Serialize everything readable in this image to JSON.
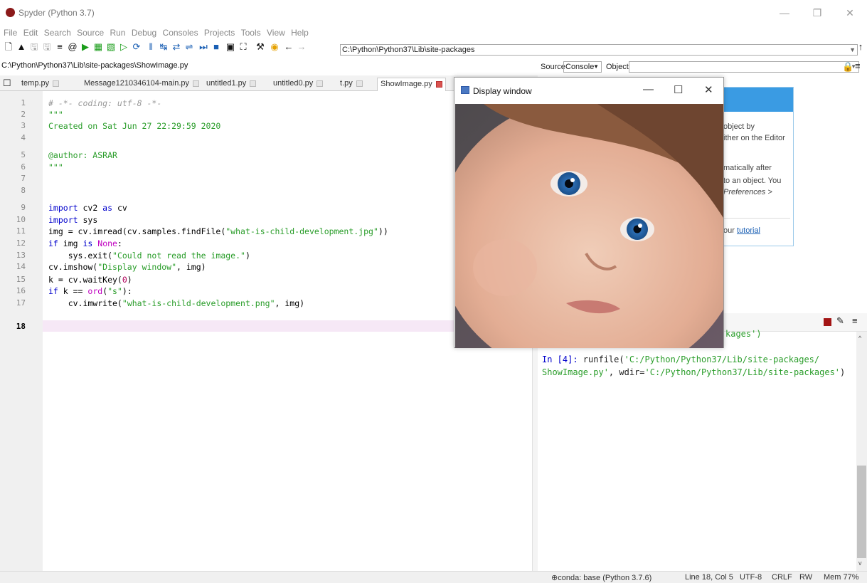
{
  "window": {
    "title": "Spyder (Python 3.7)"
  },
  "menu": [
    "File",
    "Edit",
    "Search",
    "Source",
    "Run",
    "Debug",
    "Consoles",
    "Projects",
    "Tools",
    "View",
    "Help"
  ],
  "toolbar": {
    "working_dir": "C:\\Python\\Python37\\Lib\\site-packages",
    "icons": [
      "new-file",
      "open-file",
      "save",
      "save-all",
      "outline",
      "at",
      "run",
      "run-cell",
      "run-cell-advance",
      "run-selection",
      "debug",
      "step",
      "step-into",
      "step-return",
      "continue",
      "stop",
      "maximize",
      "fullscreen",
      "preferences",
      "python-path",
      "back",
      "forward"
    ]
  },
  "editor": {
    "file_path": "C:\\Python\\Python37\\Lib\\site-packages\\ShowImage.py",
    "tabs": [
      {
        "label": "temp.py"
      },
      {
        "label": "Message1210346104-main.py"
      },
      {
        "label": "untitled1.py"
      },
      {
        "label": "untitled0.py"
      },
      {
        "label": "t.py"
      },
      {
        "label": "ShowImage.py"
      }
    ],
    "line_numbers": [
      "1",
      "2",
      "3",
      "4",
      "5",
      "6",
      "7",
      "8",
      "9",
      "10",
      "11",
      "12",
      "13",
      "14",
      "15",
      "16",
      "17",
      "18"
    ],
    "code": {
      "l1": "# -*- coding: utf-8 -*-",
      "l2": "\"\"\"",
      "l3": "Created on Sat Jun 27 22:29:59 2020",
      "l5": "@author: ASRAR",
      "l6": "\"\"\"",
      "l9_kw": "import",
      "l9_rest": " cv2 ",
      "l9_as": "as",
      "l9_end": " cv",
      "l10_kw": "import",
      "l10_rest": " sys",
      "l11_a": "img = cv.imread(cv.samples.findFile(",
      "l11_s": "\"what-is-child-development.jpg\"",
      "l11_b": "))",
      "l12_kw": "if",
      "l12_a": " img ",
      "l12_is": "is",
      "l12_b": " ",
      "l12_none": "None",
      "l12_c": ":",
      "l13_a": "    sys.exit(",
      "l13_s": "\"Could not read the image.\"",
      "l13_b": ")",
      "l14_a": "cv.imshow(",
      "l14_s": "\"Display window\"",
      "l14_b": ", img)",
      "l15_a": "k = cv.waitKey(",
      "l15_n": "0",
      "l15_b": ")",
      "l16_kw": "if",
      "l16_a": " k == ",
      "l16_ord": "ord",
      "l16_b": "(",
      "l16_s": "\"s\"",
      "l16_c": "):",
      "l17_a": "    cv.imwrite(",
      "l17_s": "\"what-is-child-development.png\"",
      "l17_b": ", img)"
    }
  },
  "help": {
    "source_label": "Source",
    "source_value": "Console",
    "object_label": "Object",
    "lines": [
      "object by",
      "ither on the Editor",
      "matically after",
      "to an object. You",
      "Preferences >"
    ],
    "tutorial_prefix": "our ",
    "tutorial_link": "tutorial"
  },
  "console": {
    "partial": "kages')",
    "prompt": "In [4]: ",
    "cmd_a": "runfile(",
    "cmd_s1": "'C:/Python/Python37/Lib/site-packages/",
    "cmd_s1b": "ShowImage.py'",
    "cmd_b": ", wdir=",
    "cmd_s2": "'C:/Python/Python37/Lib/site-packages'",
    "cmd_c": ")"
  },
  "display_window": {
    "title": "Display window"
  },
  "status": {
    "conda": "conda: base (Python 3.7.6)",
    "position": "Line 18, Col 5",
    "encoding": "UTF-8",
    "eol": "CRLF",
    "permissions": "RW",
    "memory": "Mem 77%"
  },
  "colors": {
    "accent": "#3a9be3",
    "string": "#2a9d2a",
    "keyword": "#0000cc",
    "current_line": "#f6e8f6"
  }
}
